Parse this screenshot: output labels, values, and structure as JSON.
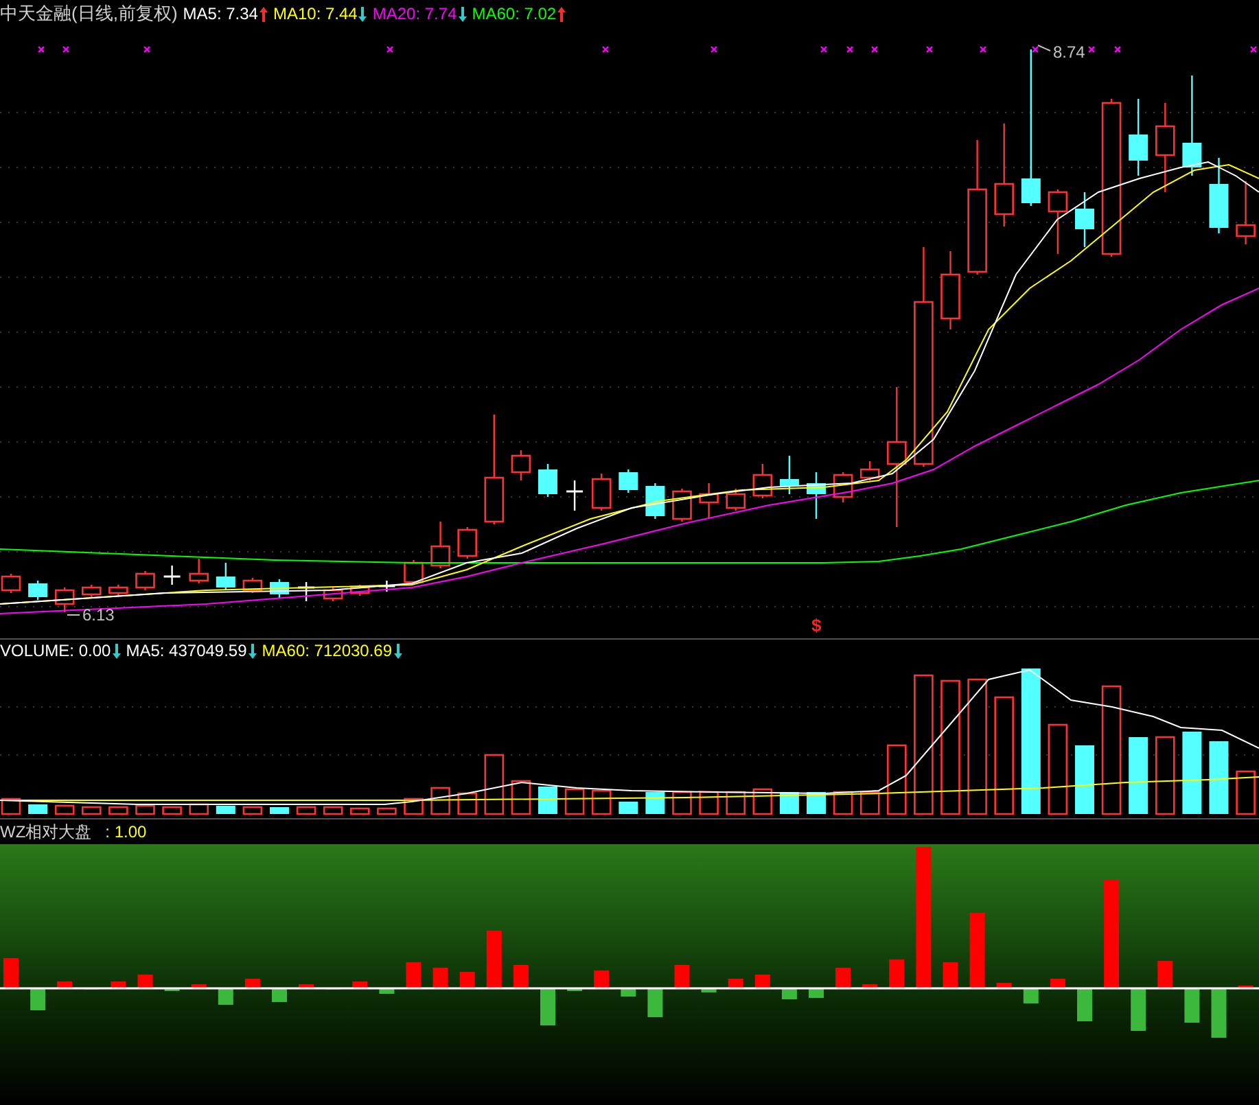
{
  "price_panel": {
    "title": "中天金融(日线,前复权)",
    "legend": [
      {
        "label": "MA5: 7.34",
        "rising": true,
        "color": "#ffffff"
      },
      {
        "label": "MA10: 7.44",
        "rising": false,
        "color": "#ffff00"
      },
      {
        "label": "MA20: 7.74",
        "rising": false,
        "color": "#ff00ff"
      },
      {
        "label": "MA60: 7.02",
        "rising": true,
        "color": "#00ff00"
      }
    ],
    "high_label": "8.74",
    "low_label": "6.13",
    "signal_mark": "$"
  },
  "volume_panel": {
    "legend": [
      {
        "label": "VOLUME: 0.00",
        "rising": false,
        "color": "#ffffff"
      },
      {
        "label": "MA5: 437049.59",
        "rising": false,
        "color": "#ffffff"
      },
      {
        "label": "MA60: 712030.69",
        "rising": false,
        "color": "#ffff00"
      }
    ]
  },
  "indicator_panel": {
    "name": "WZ相对大盘",
    "value": ": 1.00"
  }
}
